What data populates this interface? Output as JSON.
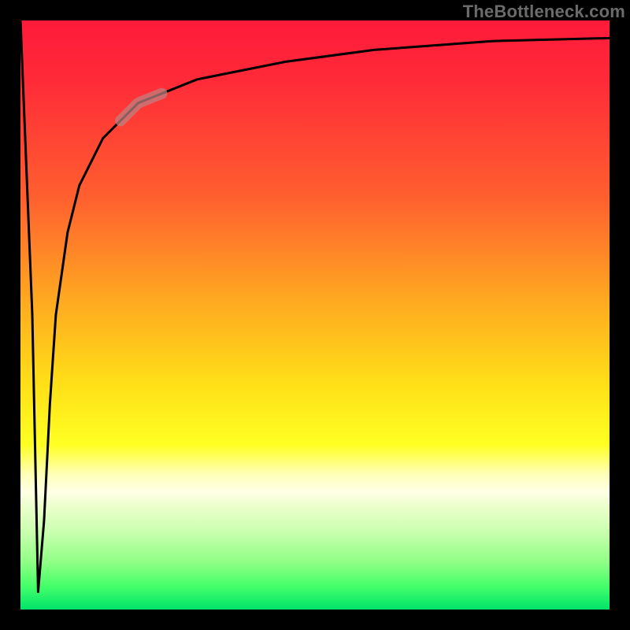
{
  "attribution": "TheBottleneck.com",
  "chart_data": {
    "type": "line",
    "title": "",
    "xlabel": "",
    "ylabel": "",
    "xlim": [
      0,
      100
    ],
    "ylim": [
      0,
      100
    ],
    "grid": false,
    "legend": false,
    "series": [
      {
        "name": "curve",
        "x": [
          0,
          2,
          3,
          4,
          5,
          6,
          8,
          10,
          14,
          20,
          30,
          45,
          60,
          80,
          100
        ],
        "y": [
          100,
          50,
          3,
          15,
          35,
          50,
          64,
          72,
          80,
          86,
          90,
          93,
          95,
          96.5,
          97
        ]
      }
    ],
    "highlight_segment": {
      "series": "curve",
      "x_range": [
        17,
        24
      ]
    }
  }
}
